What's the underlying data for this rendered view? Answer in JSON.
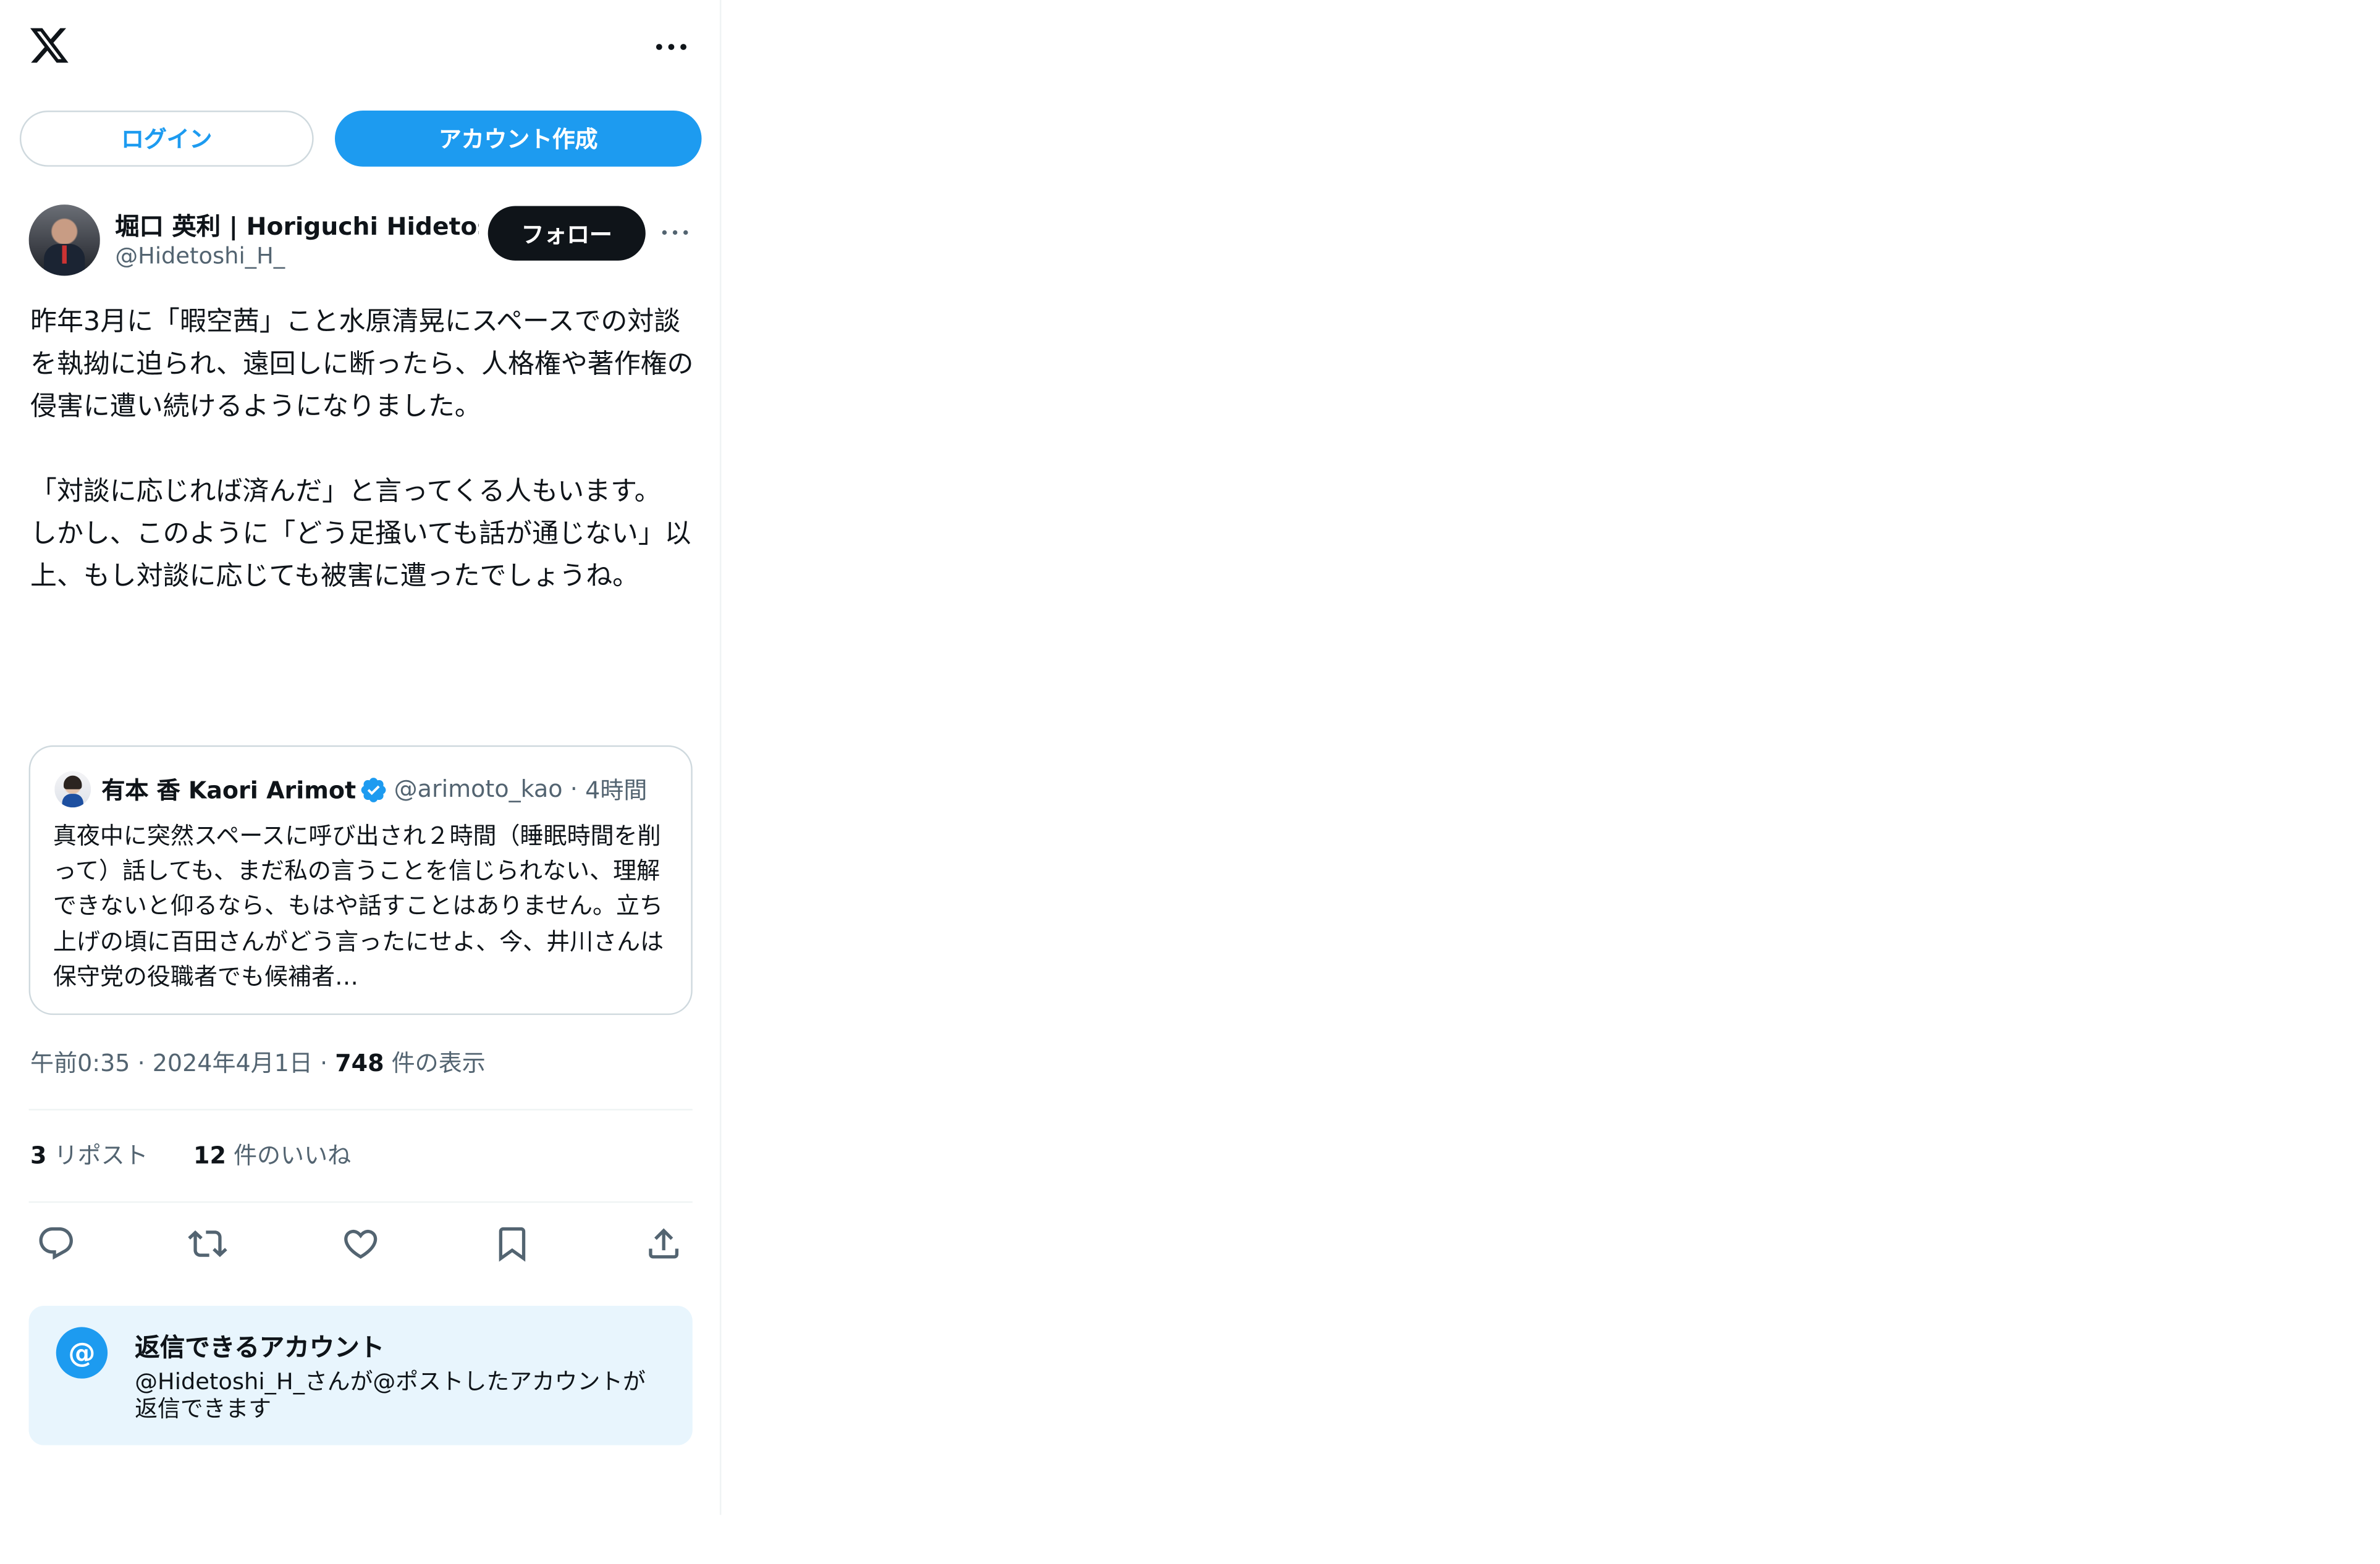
{
  "header": {
    "logo": "x-logo-icon",
    "more_icon": "more-horizontal-icon"
  },
  "auth": {
    "login_label": "ログイン",
    "signup_label": "アカウント作成"
  },
  "post": {
    "author_name": "堀口 英利 | Horiguchi Hidetoshi",
    "author_handle": "@Hidetoshi_H_",
    "follow_label": "フォロー",
    "text": "昨年3月に「暇空茜」こと水原清晃にスペースでの対談を執拗に迫られ、遠回しに断ったら、人格権や著作権の侵害に遭い続けるようになりました。\n\n「対談に応じれば済んだ」と言ってくる人もいます。\nしかし、このように「どう足掻いても話が通じない」以上、もし対談に応じても被害に遭ったでしょうね。",
    "time": "午前0:35",
    "date": "2024年4月1日",
    "views_count": "748",
    "views_label": "件の表示",
    "reposts_count": "3",
    "reposts_label": "リポスト",
    "likes_count": "12",
    "likes_label": "件のいいね"
  },
  "quote": {
    "name": "有本 香 Kaori Arimoto",
    "handle": "@arimoto_kao",
    "time": "4時間",
    "text": "真夜中に突然スペースに呼び出され２時間（睡眠時間を削って）話しても、まだ私の言うことを信じられない、理解できないと仰るなら、もはや話すことはありません。立ち上げの頃に百田さんがどう言ったにせよ、今、井川さんは保守党の役職者でも候補者…"
  },
  "actions": {
    "reply_icon": "reply-icon",
    "repost_icon": "repost-icon",
    "like_icon": "heart-icon",
    "bookmark_icon": "bookmark-icon",
    "share_icon": "share-icon"
  },
  "reply_settings": {
    "icon_text": "@",
    "title": "返信できるアカウント",
    "description": "@Hidetoshi_H_さんが@ポストしたアカウントが返信できます"
  },
  "colors": {
    "accent": "#1d9bf0",
    "text_primary": "#0f1419",
    "text_secondary": "#536471",
    "border": "#cfd9de",
    "reply_box_bg": "#e8f5fd"
  }
}
